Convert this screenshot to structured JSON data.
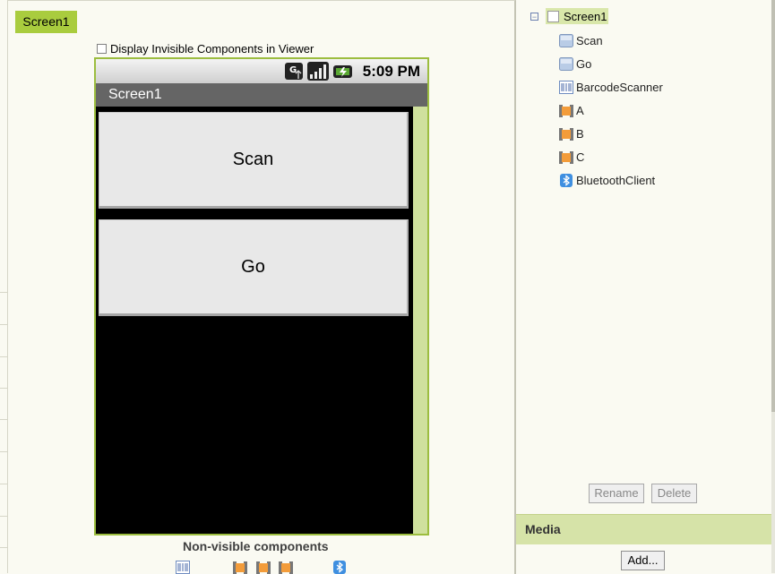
{
  "viewer": {
    "screen_tab": "Screen1",
    "display_invisible_label": "Display Invisible Components in Viewer",
    "display_invisible_checked": false,
    "phone": {
      "status_time": "5:09 PM",
      "title": "Screen1",
      "buttons": [
        {
          "label": "Scan"
        },
        {
          "label": "Go"
        }
      ]
    },
    "nonvisible_title": "Non-visible components",
    "nonvisible_icons": [
      "barcode-scanner-icon",
      "clock-icon",
      "clock-icon",
      "clock-icon",
      "bluetooth-icon"
    ]
  },
  "components": {
    "root": {
      "label": "Screen1",
      "icon": "screen-icon",
      "expanded": true
    },
    "items": [
      {
        "label": "Scan",
        "icon": "button-icon"
      },
      {
        "label": "Go",
        "icon": "button-icon"
      },
      {
        "label": "BarcodeScanner",
        "icon": "barcode-scanner-icon"
      },
      {
        "label": "A",
        "icon": "clock-icon"
      },
      {
        "label": "B",
        "icon": "clock-icon"
      },
      {
        "label": "C",
        "icon": "clock-icon"
      },
      {
        "label": "BluetoothClient",
        "icon": "bluetooth-icon"
      }
    ],
    "rename_label": "Rename",
    "delete_label": "Delete"
  },
  "media": {
    "title": "Media",
    "add_label": "Add..."
  },
  "colors": {
    "accent": "#a9cc3e",
    "phone_border": "#9cbd3f",
    "title_bar": "#656565",
    "selected_bg": "#d9e7aa",
    "media_header": "#d6e3a8"
  }
}
